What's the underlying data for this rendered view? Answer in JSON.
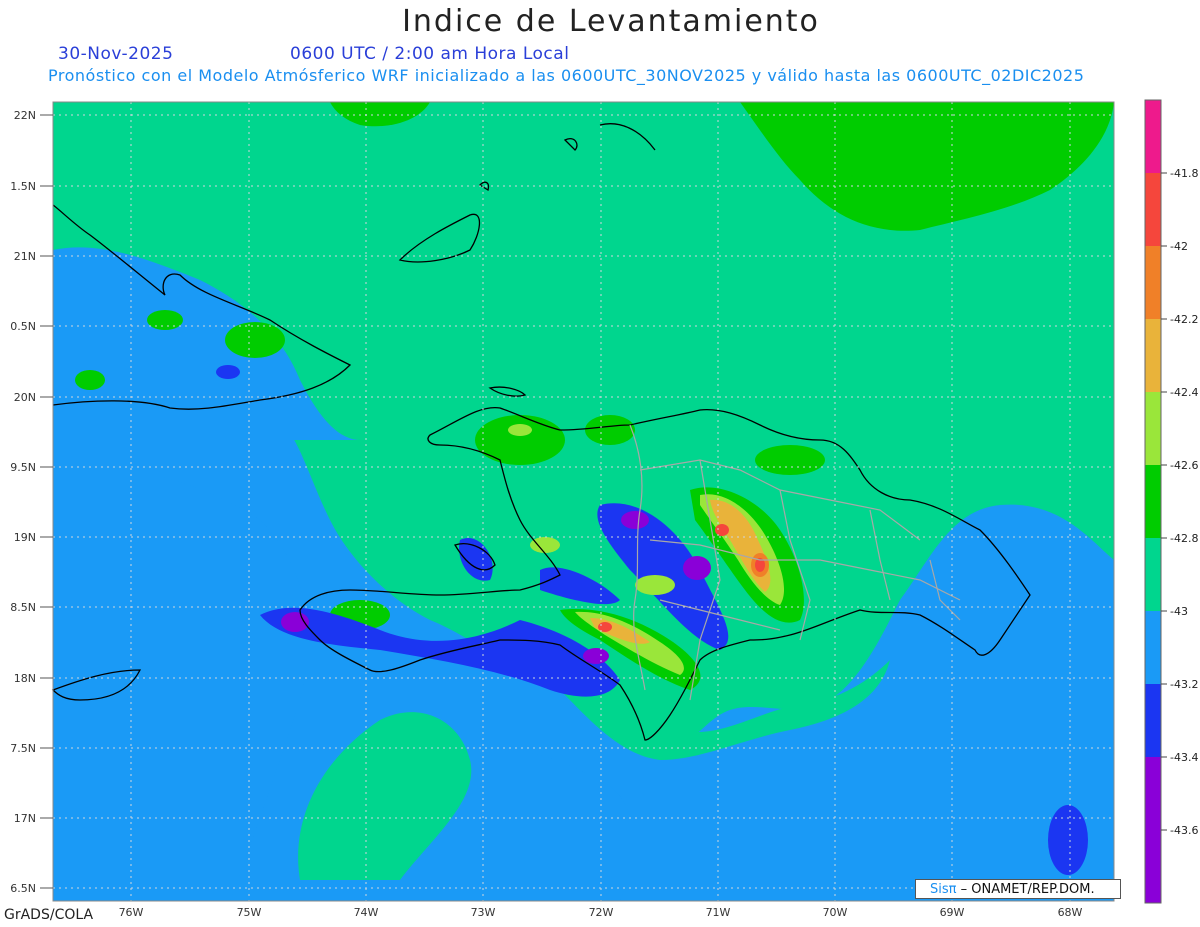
{
  "header": {
    "title": "Indice de Levantamiento",
    "date": "30-Nov-2025",
    "time": "0600 UTC / 2:00 am Hora Local",
    "subtitle": "Pronóstico con el Modelo Atmósferico WRF inicializado a las 0600UTC_30NOV2025 y válido hasta las  0600UTC_02DIC2025"
  },
  "map": {
    "lat_labels": [
      "22N",
      "1.5N",
      "21N",
      "0.5N",
      "20N",
      "9.5N",
      "19N",
      "8.5N",
      "18N",
      "7.5N",
      "17N",
      "6.5N"
    ],
    "lon_labels": [
      "76W",
      "75W",
      "74W",
      "73W",
      "72W",
      "71W",
      "70W",
      "69W",
      "68W"
    ]
  },
  "colorbar": {
    "labels": [
      "-41.8",
      "-42",
      "-42.2",
      "-42.4",
      "-42.6",
      "-42.8",
      "-43",
      "-43.2",
      "-43.4",
      "-43.6"
    ],
    "colors": [
      "#8a00d8",
      "#1b36f2",
      "#1a9af6",
      "#00d68e",
      "#00cc00",
      "#9ae63a",
      "#e9b33a",
      "#f08028",
      "#f5463c",
      "#ee1a8c"
    ]
  },
  "footer": {
    "credit": "GrADS/COLA",
    "sis_mark": "Sisπ",
    "sis_text": " – ONAMET/REP.DOM."
  }
}
